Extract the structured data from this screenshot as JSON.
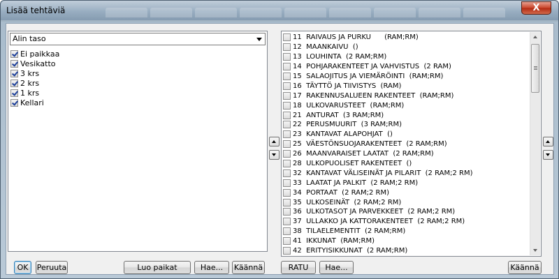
{
  "window": {
    "title": "Lisää tehtäviä",
    "close_label": "X"
  },
  "left": {
    "level_select": "Alin taso",
    "levels": [
      {
        "label": "Ei paikkaa",
        "checked": true
      },
      {
        "label": "Vesikatto",
        "checked": true
      },
      {
        "label": "3 krs",
        "checked": true
      },
      {
        "label": "2 krs",
        "checked": true
      },
      {
        "label": "1 krs",
        "checked": true
      },
      {
        "label": "Kellari",
        "checked": true
      }
    ]
  },
  "tasks": [
    "11  RAIVAUS JA PURKU      (RAM;RM)",
    "12  MAANKAIVU  ()",
    "13  LOUHINTA  (2 RAM;RM)",
    "14  POHJARAKENTEET JA VAHVISTUS  (2 RAM)",
    "15  SALAOJITUS JA VIEMÄRÖINTI  (RAM;RM)",
    "16  TÄYTTÖ JA TIIVISTYS  (RAM)",
    "17  RAKENNUSALUEEN RAKENTEET  (RAM;RM)",
    "18  ULKOVARUSTEET  (RAM;RM)",
    "21  ANTURAT  (3 RAM;RM)",
    "22  PERUSMUURIT  (3 RAM;RM)",
    "23  KANTAVAT ALAPOHJAT  ()",
    "25  VÄESTÖNSUOJARAKENTEET  (2 RAM;RM)",
    "26  MAANVARAISET LAATAT  (2 RAM;RM)",
    "28  ULKOPUOLISET RAKENTEET  ()",
    "32  KANTAVAT VÄLISEINÄT JA PILARIT  (2 RAM;2 RM)",
    "33  LAATAT JA PALKIT  (2 RAM;2 RM)",
    "34  PORTAAT  (2 RAM;2 RM)",
    "35  ULKOSEINÄT  (2 RAM;2 RM)",
    "36  ULKOTASOT JA PARVEKKEET  (2 RAM;2 RM)",
    "37  ULLAKKO JA KATTORAKENTEET  (2 RAM;2 RM)",
    "38  TILAELEMENTIT  (2 RAM;RM)",
    "41  IKKUNAT  (RAM;RM)",
    "42  ERITYISIKKUNAT  (2 RAM;RM)"
  ],
  "buttons": {
    "ok": "OK",
    "cancel": "Peruuta",
    "create_places": "Luo paikat",
    "search_left": "Hae...",
    "invert_left": "Käännä",
    "ratu": "RATU",
    "search_right": "Hae...",
    "invert_right": "Käännä"
  }
}
